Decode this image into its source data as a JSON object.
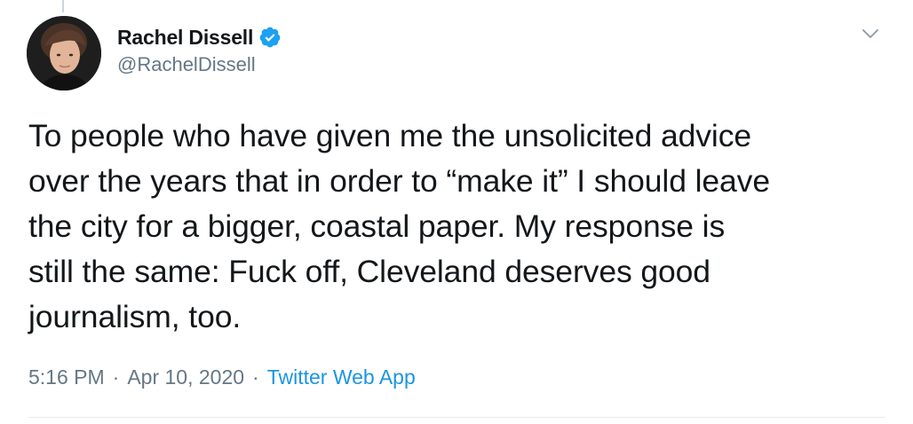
{
  "tweet": {
    "display_name": "Rachel Dissell",
    "handle": "@RachelDissell",
    "text": "To people who have given me the unsolicited advice\nover the years that in order to “make it” I should leave\nthe city for a bigger, coastal paper. My response is\nstill the same: Fuck off, Cleveland deserves good\njournalism, too.",
    "time": "5:16 PM",
    "separator": "·",
    "date": "Apr 10, 2020",
    "source": "Twitter Web App"
  },
  "icons": {
    "verified": "verified-badge-icon",
    "menu": "chevron-down-icon"
  },
  "colors": {
    "text_primary": "#14171a",
    "text_secondary": "#657786",
    "link": "#1b95e0",
    "verified_badge": "#1da1f2",
    "divider": "#e6ecf0"
  }
}
